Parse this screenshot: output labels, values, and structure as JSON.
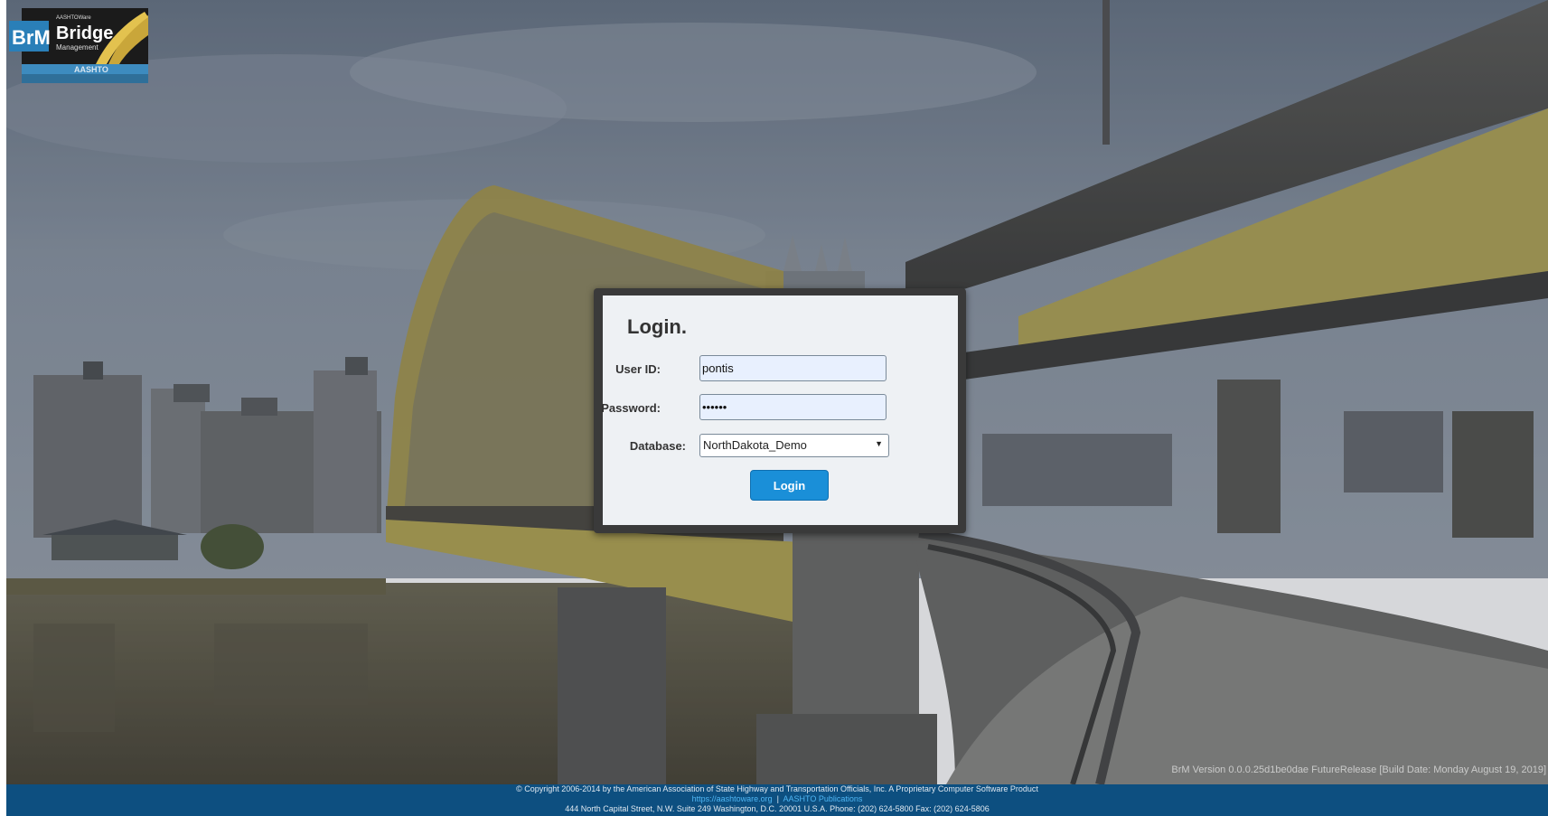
{
  "logo": {
    "badge": "BrM",
    "small_text": "AASHTOWare",
    "title": "Bridge",
    "subtitle": "Management",
    "org": "AASHTO"
  },
  "login": {
    "title": "Login.",
    "user_id_label": "User ID:",
    "user_id_value": "pontis",
    "password_label": "Password:",
    "password_value": "••••••",
    "database_label": "Database:",
    "database_value": "NorthDakota_Demo",
    "button_label": "Login"
  },
  "version_text": "BrM Version 0.0.0.25d1be0dae FutureRelease [Build Date: Monday August 19, 2019]",
  "footer": {
    "copyright": "© Copyright 2006-2014 by the American Association of State Highway and Transportation Officials, Inc. A Proprietary Computer Software Product",
    "link_site": "https://aashtoware.org",
    "separator": "|",
    "link_publications": "AASHTO Publications",
    "address": "444 North Capital Street, N.W. Suite 249 Washington, D.C. 20001 U.S.A. Phone: (202) 624-5800 Fax: (202) 624-5806"
  },
  "colors": {
    "footer_bg": "#0d4f80",
    "button_bg": "#1a8fd8",
    "link": "#4fb7f5",
    "bridge_yellow": "#b9a94a"
  }
}
